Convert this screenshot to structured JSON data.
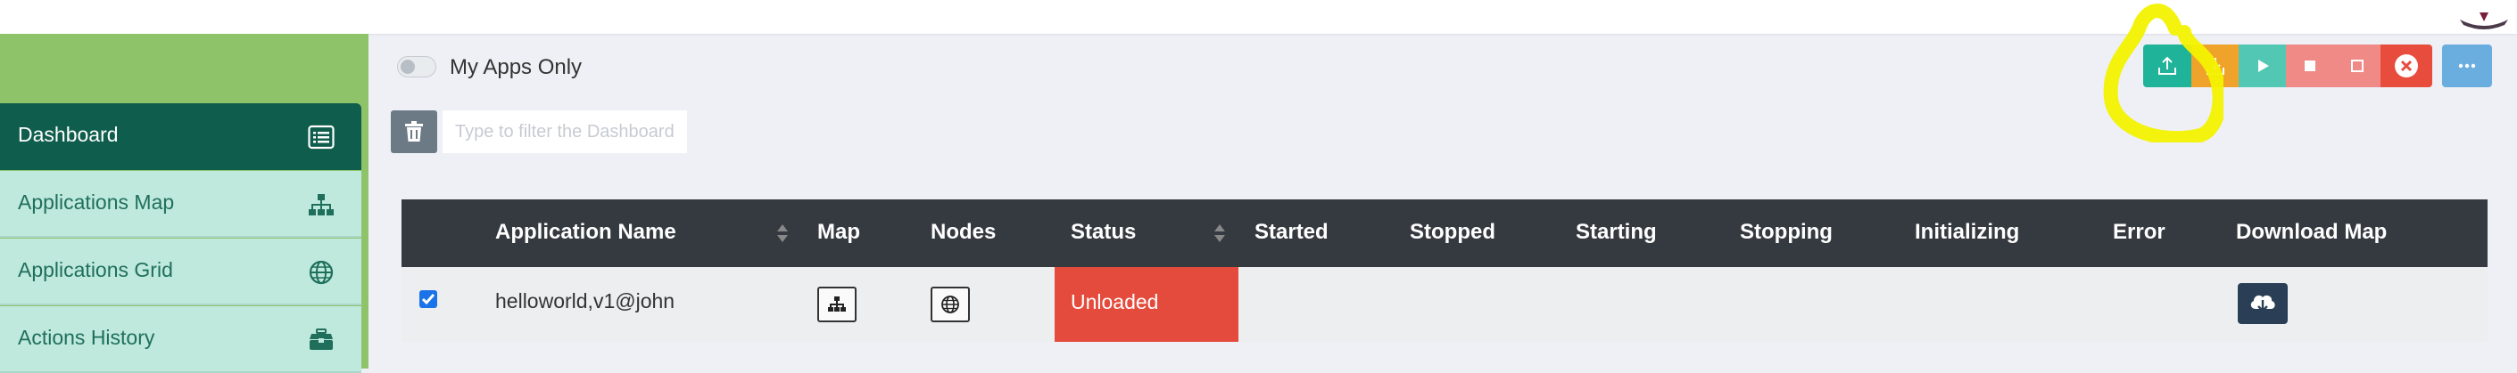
{
  "sidebar": {
    "items": [
      {
        "label": "Dashboard",
        "icon": "list-icon",
        "active": true
      },
      {
        "label": "Applications Map",
        "icon": "sitemap-icon",
        "active": false
      },
      {
        "label": "Applications Grid",
        "icon": "globe-icon",
        "active": false
      },
      {
        "label": "Actions History",
        "icon": "toolbox-icon",
        "active": false
      }
    ]
  },
  "filters": {
    "my_apps_label": "My Apps Only",
    "my_apps_on": false,
    "filter_placeholder": "Type to filter the Dashboard"
  },
  "toolbar": {
    "buttons": [
      {
        "name": "upload-button",
        "icon": "upload-icon",
        "color": "#1fb39a"
      },
      {
        "name": "download-button",
        "icon": "download-icon",
        "color": "#f0a32a"
      },
      {
        "name": "start-button",
        "icon": "play-icon",
        "color": "#52c8b4"
      },
      {
        "name": "stop-button",
        "icon": "stop-icon",
        "color": "#f08a86"
      },
      {
        "name": "pause-button",
        "icon": "square-outline-icon",
        "color": "#f08a86"
      },
      {
        "name": "remove-button",
        "icon": "close-circle-icon",
        "color": "#e84c3d"
      },
      {
        "name": "more-button",
        "icon": "ellipsis-icon",
        "color": "#6aaee0"
      }
    ]
  },
  "table": {
    "headers": {
      "name": "Application Name",
      "map": "Map",
      "nodes": "Nodes",
      "status": "Status",
      "started": "Started",
      "stopped": "Stopped",
      "starting": "Starting",
      "stopping": "Stopping",
      "initializing": "Initializing",
      "error": "Error",
      "download_map": "Download Map"
    },
    "rows": [
      {
        "checked": true,
        "name": "helloworld,v1@john",
        "status": "Unloaded",
        "started": "",
        "stopped": "",
        "starting": "",
        "stopping": "",
        "initializing": "",
        "error": ""
      }
    ]
  },
  "colors": {
    "sidebar_active": "#0f5d4c",
    "sidebar_item": "#bfe9dd",
    "sidebar_bg": "#8fc36a",
    "table_header": "#353a40",
    "status_unloaded": "#e54b3c",
    "highlight": "#f2f200"
  }
}
